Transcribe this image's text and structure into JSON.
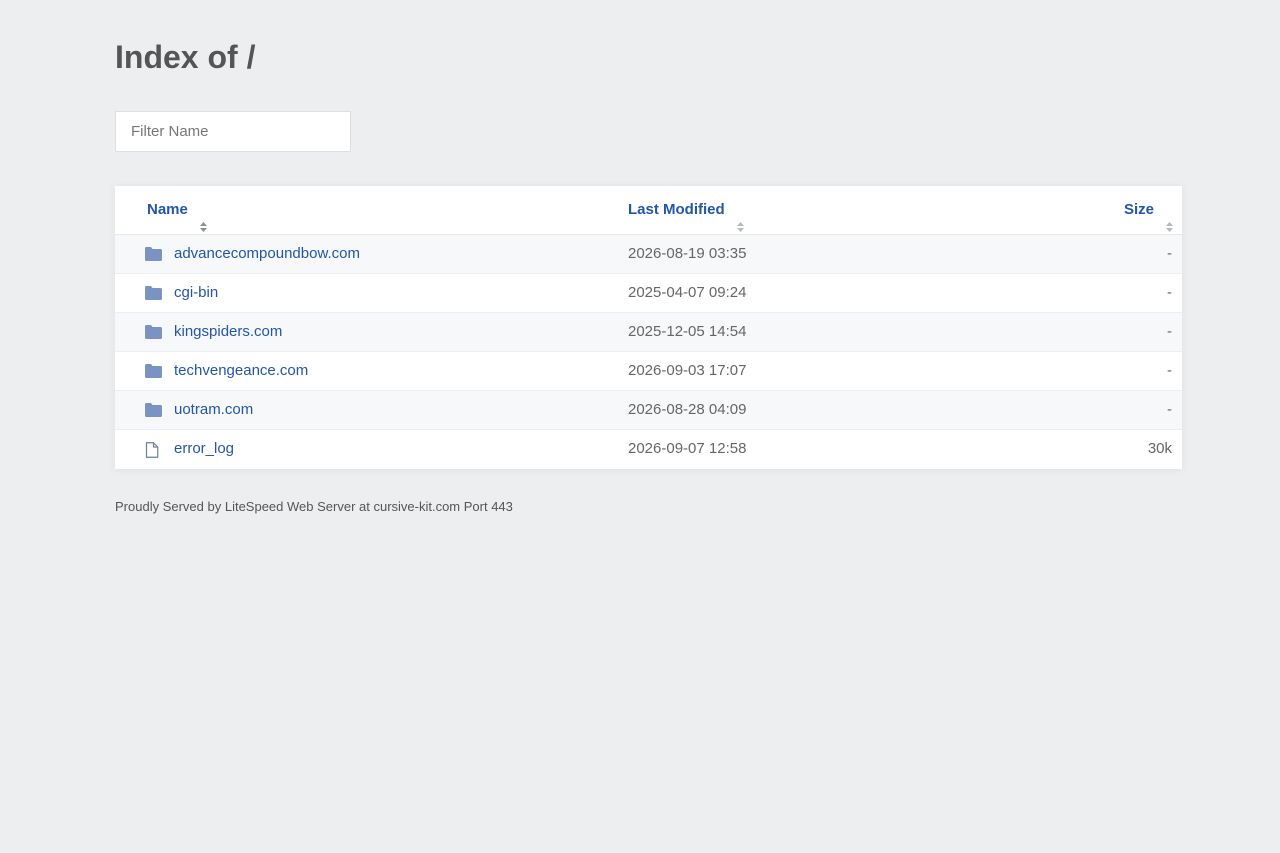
{
  "page": {
    "title": "Index of /"
  },
  "filter": {
    "placeholder": "Filter Name",
    "value": ""
  },
  "table": {
    "columns": {
      "name": "Name",
      "modified": "Last Modified",
      "size": "Size"
    },
    "rows": [
      {
        "type": "folder",
        "icon": "folder-icon",
        "name": "advancecompoundbow.com",
        "modified": "2026-08-19 03:35",
        "size": "-"
      },
      {
        "type": "folder",
        "icon": "folder-icon",
        "name": "cgi-bin",
        "modified": "2025-04-07 09:24",
        "size": "-"
      },
      {
        "type": "folder",
        "icon": "folder-icon",
        "name": "kingspiders.com",
        "modified": "2025-12-05 14:54",
        "size": "-"
      },
      {
        "type": "folder",
        "icon": "folder-icon",
        "name": "techvengeance.com",
        "modified": "2026-09-03 17:07",
        "size": "-"
      },
      {
        "type": "folder",
        "icon": "folder-icon",
        "name": "uotram.com",
        "modified": "2026-08-28 04:09",
        "size": "-"
      },
      {
        "type": "file",
        "icon": "file-icon",
        "name": "error_log",
        "modified": "2026-09-07 12:58",
        "size": "30k"
      }
    ]
  },
  "footer": {
    "text": "Proudly Served by LiteSpeed Web Server at cursive-kit.com Port 443"
  },
  "colors": {
    "background": "#eceef0",
    "link": "#2356a8",
    "folder_icon": "#7b93c2",
    "file_icon": "#6a7fa8"
  }
}
